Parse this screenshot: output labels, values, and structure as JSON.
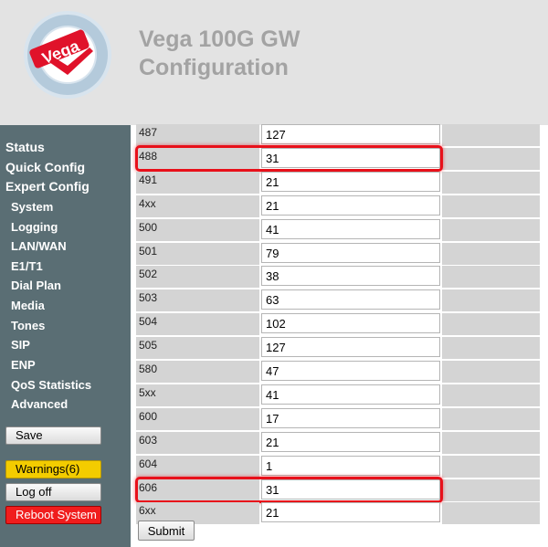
{
  "header": {
    "logo_text": "Vega",
    "title_line1": "Vega 100G GW",
    "title_line2": "Configuration"
  },
  "sidebar": {
    "top_items": [
      "Status",
      "Quick Config",
      "Expert Config"
    ],
    "sub_items": [
      "System",
      "Logging",
      "LAN/WAN",
      "E1/T1",
      "Dial Plan",
      "Media",
      "Tones",
      "SIP",
      "ENP",
      "QoS Statistics",
      "Advanced"
    ],
    "save_label": "Save",
    "warnings_label": "Warnings(6)",
    "logoff_label": "Log off",
    "reboot_label": "Reboot System"
  },
  "table": {
    "rows": [
      {
        "code": "487",
        "value": "127"
      },
      {
        "code": "488",
        "value": "31"
      },
      {
        "code": "491",
        "value": "21"
      },
      {
        "code": "4xx",
        "value": "21"
      },
      {
        "code": "500",
        "value": "41"
      },
      {
        "code": "501",
        "value": "79"
      },
      {
        "code": "502",
        "value": "38"
      },
      {
        "code": "503",
        "value": "63"
      },
      {
        "code": "504",
        "value": "102"
      },
      {
        "code": "505",
        "value": "127"
      },
      {
        "code": "580",
        "value": "47"
      },
      {
        "code": "5xx",
        "value": "41"
      },
      {
        "code": "600",
        "value": "17"
      },
      {
        "code": "603",
        "value": "21"
      },
      {
        "code": "604",
        "value": "1"
      },
      {
        "code": "606",
        "value": "31"
      },
      {
        "code": "6xx",
        "value": "21"
      }
    ],
    "highlighted_codes": [
      "488",
      "606"
    ],
    "submit_label": "Submit"
  },
  "colors": {
    "highlight": "#e8101a",
    "sidebar_bg": "#5a6e74",
    "header_bg": "#e3e3e3",
    "warning": "#f3cc00",
    "reboot": "#f01d1d"
  }
}
